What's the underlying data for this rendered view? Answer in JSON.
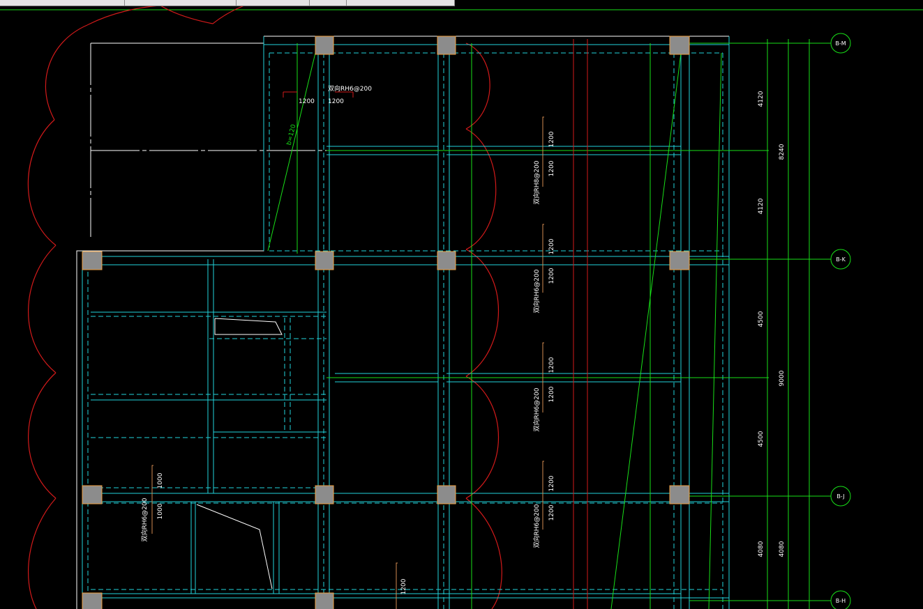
{
  "colors": {
    "background": "#000000",
    "cloud": "#d21a1a",
    "beam": "#22d4dc",
    "dimension": "#18e018",
    "slab_outline": "#ffffff",
    "column_fill": "#8c8c8c",
    "column_edge": "#f0a040"
  },
  "toolbar": {
    "fields": [
      "",
      "",
      "",
      "",
      ""
    ]
  },
  "axes": [
    {
      "label": "B-M"
    },
    {
      "label": "B-K"
    },
    {
      "label": "B-J"
    },
    {
      "label": "B-H"
    }
  ],
  "dimensions": {
    "inner": [
      "4120",
      "4120",
      "4500",
      "4500",
      "4080"
    ],
    "outer": [
      "8240",
      "9000",
      "4080"
    ]
  },
  "slab_notes": [
    {
      "text": "双向RH6@200"
    },
    {
      "text": "双向RH8@200"
    },
    {
      "text": "双向RH6@200"
    },
    {
      "text": "双向RH6@200"
    },
    {
      "text": "双向RH6@200"
    },
    {
      "text": "双向RH6@200"
    }
  ],
  "bar_lengths": [
    {
      "text": "1200"
    },
    {
      "text": "1200"
    },
    {
      "text": "1200"
    },
    {
      "text": "1200"
    },
    {
      "text": "1200"
    },
    {
      "text": "1200"
    },
    {
      "text": "1200"
    },
    {
      "text": "1200"
    },
    {
      "text": "1200"
    },
    {
      "text": "1200"
    },
    {
      "text": "1000"
    },
    {
      "text": "1000"
    },
    {
      "text": "1200"
    }
  ],
  "slope_label": {
    "text": "b=120"
  }
}
